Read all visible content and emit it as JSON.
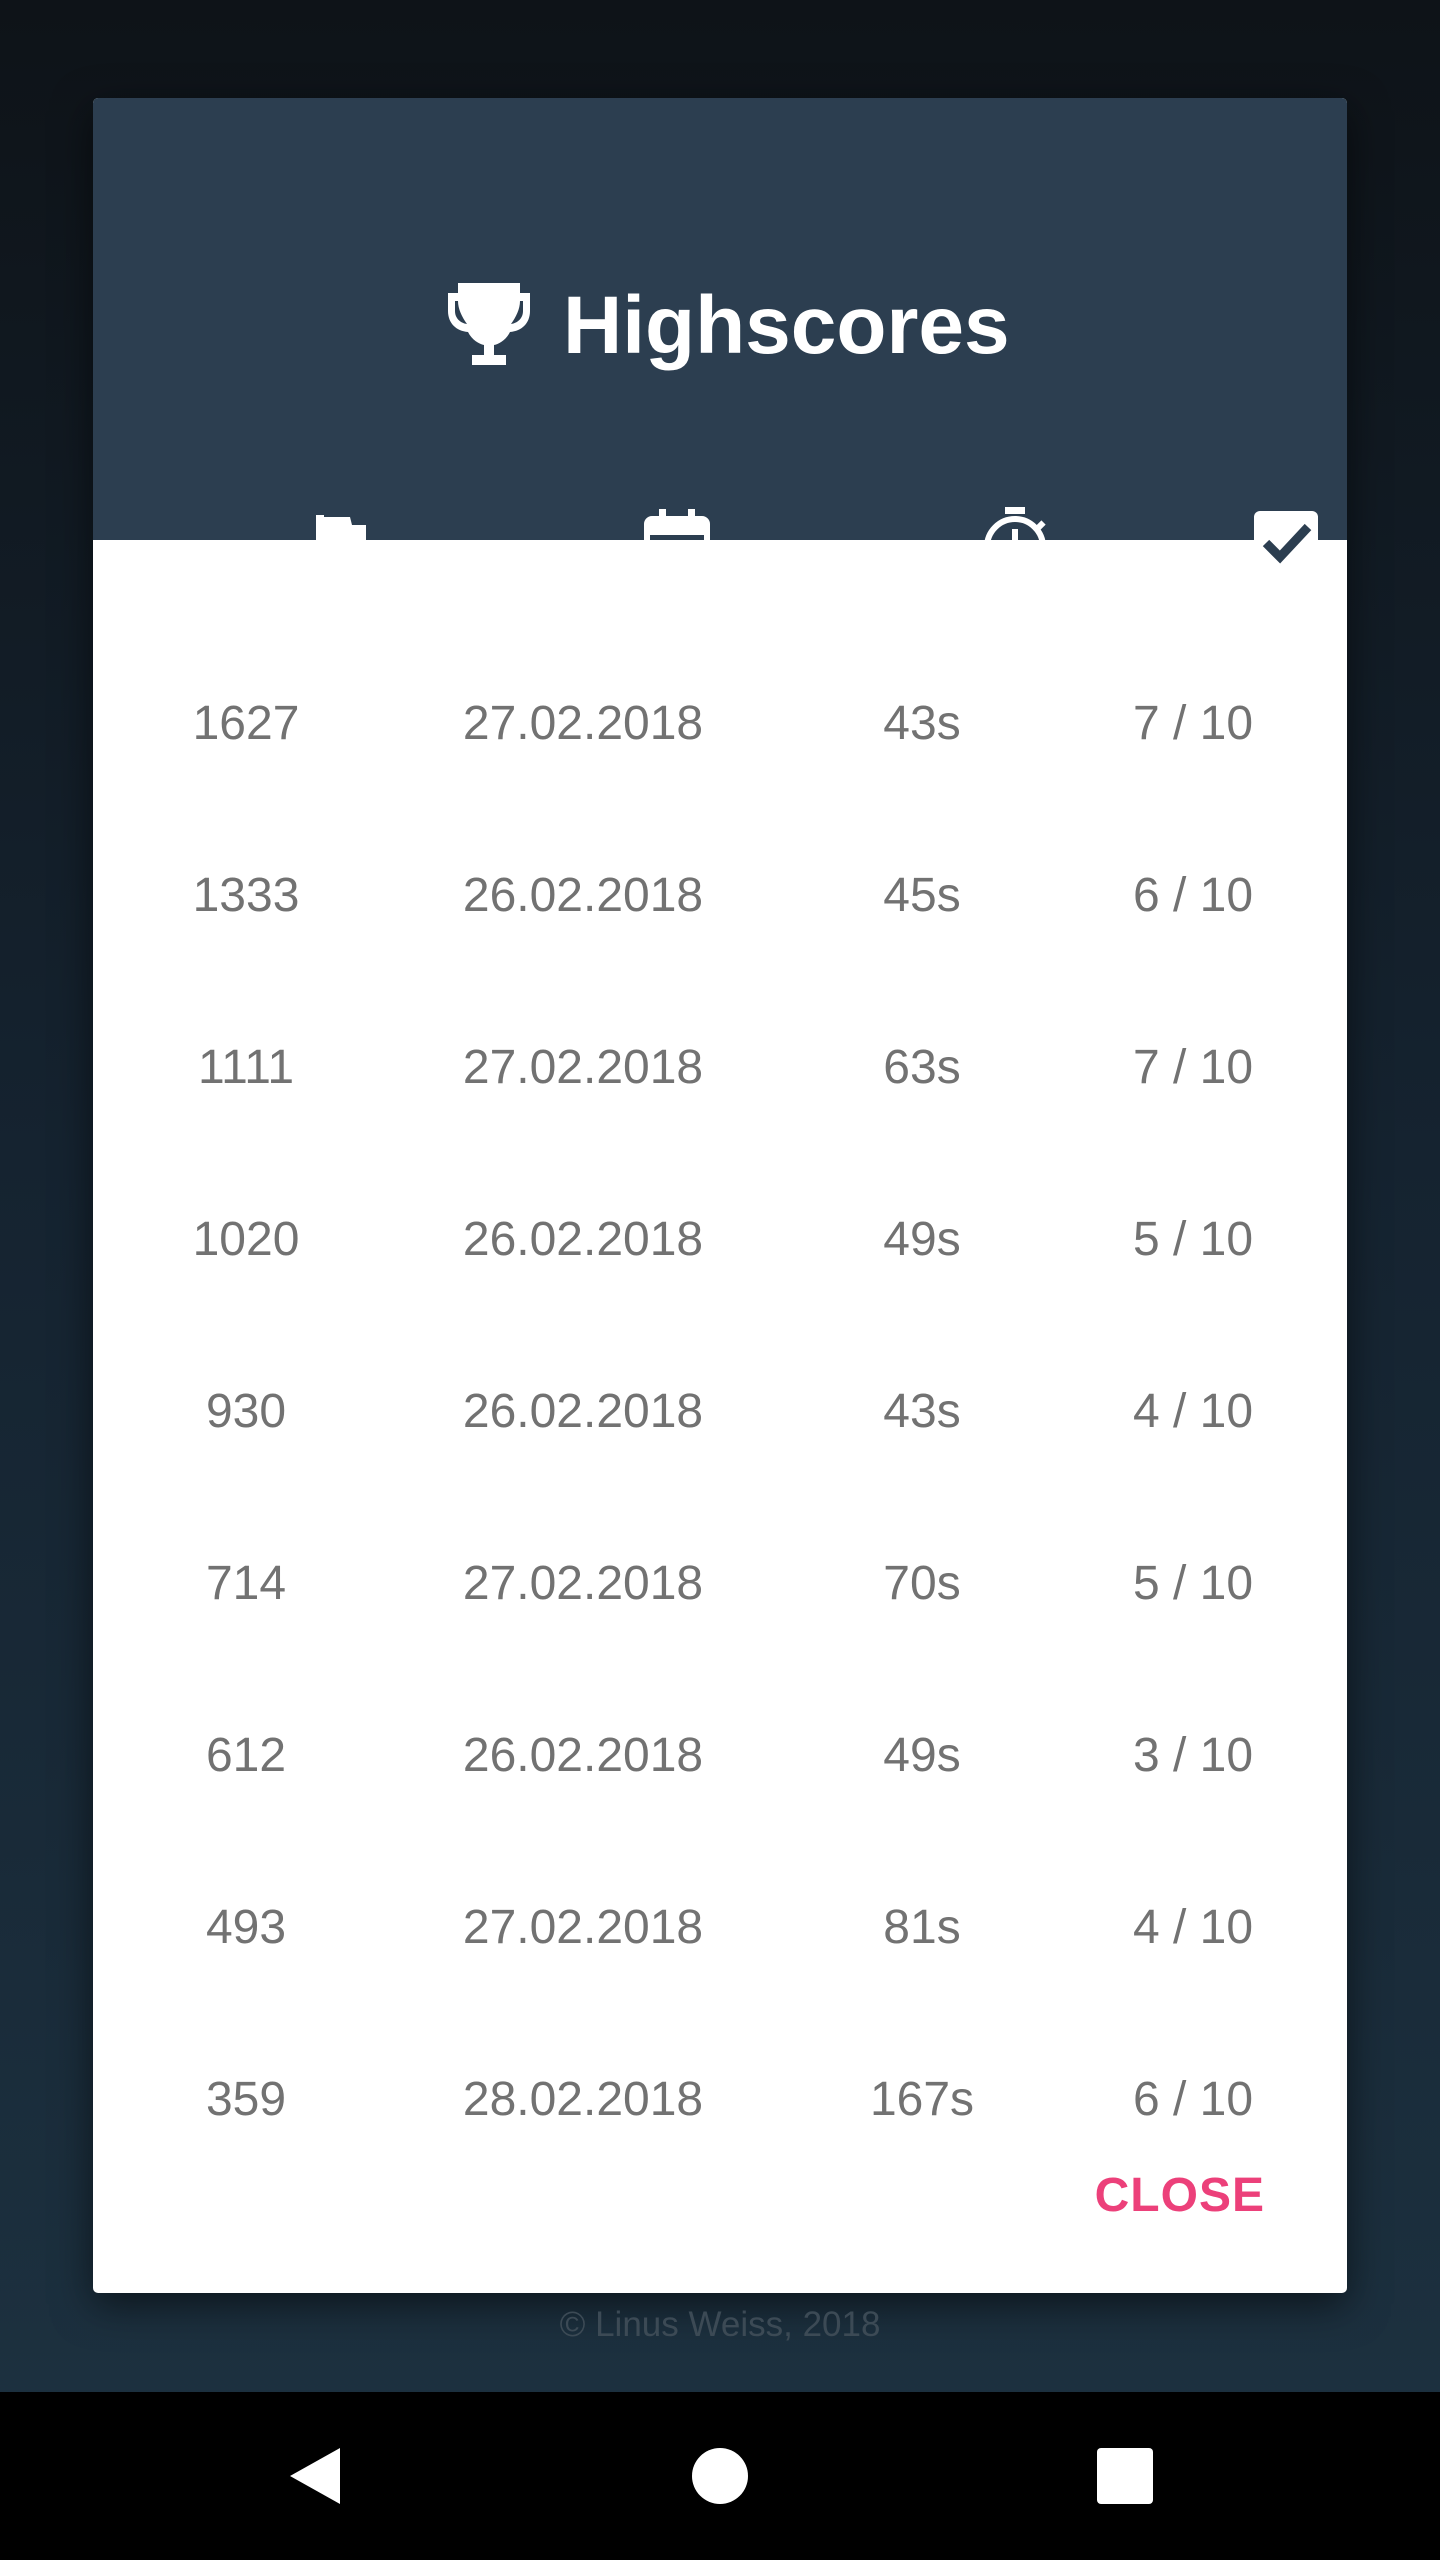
{
  "dialog": {
    "title": "Highscores",
    "icons": {
      "title": "trophy-icon",
      "columns": [
        "flag-icon",
        "calendar-icon",
        "stopwatch-icon",
        "checkbox-icon"
      ]
    },
    "rows": [
      {
        "score": "1627",
        "date": "27.02.2018",
        "time": "43s",
        "correct": "7 / 10"
      },
      {
        "score": "1333",
        "date": "26.02.2018",
        "time": "45s",
        "correct": "6 / 10"
      },
      {
        "score": "1111",
        "date": "27.02.2018",
        "time": "63s",
        "correct": "7 / 10"
      },
      {
        "score": "1020",
        "date": "26.02.2018",
        "time": "49s",
        "correct": "5 / 10"
      },
      {
        "score": "930",
        "date": "26.02.2018",
        "time": "43s",
        "correct": "4 / 10"
      },
      {
        "score": "714",
        "date": "27.02.2018",
        "time": "70s",
        "correct": "5 / 10"
      },
      {
        "score": "612",
        "date": "26.02.2018",
        "time": "49s",
        "correct": "3 / 10"
      },
      {
        "score": "493",
        "date": "27.02.2018",
        "time": "81s",
        "correct": "4 / 10"
      },
      {
        "score": "359",
        "date": "28.02.2018",
        "time": "167s",
        "correct": "6 / 10"
      }
    ],
    "close_label": "CLOSE"
  },
  "footer": {
    "copyright": "© Linus Weiss, 2018"
  },
  "nav": {
    "icons": [
      "back-icon",
      "home-icon",
      "recents-icon"
    ]
  },
  "colors": {
    "header": "#2c3e50",
    "accent": "#ec407a",
    "cell_text": "#727272"
  }
}
